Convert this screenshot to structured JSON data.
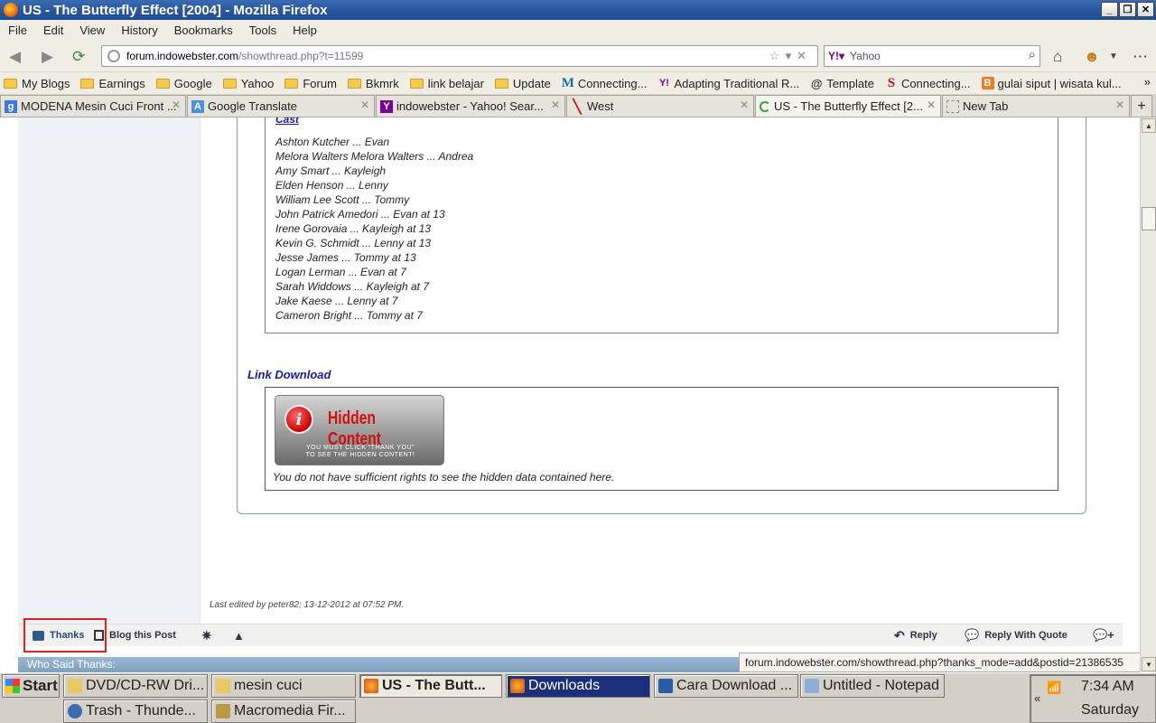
{
  "window": {
    "title": "US - The Butterfly Effect [2004] - Mozilla Firefox"
  },
  "menu": [
    "File",
    "Edit",
    "View",
    "History",
    "Bookmarks",
    "Tools",
    "Help"
  ],
  "nav": {
    "url_domain": "forum.indowebster.com",
    "url_path": "/showthread.php?t=11599",
    "search_placeholder": "Yahoo"
  },
  "bookmarks": [
    {
      "label": "My Blogs",
      "icon": "folder-icon"
    },
    {
      "label": "Earnings",
      "icon": "folder-icon"
    },
    {
      "label": "Google",
      "icon": "folder-icon"
    },
    {
      "label": "Yahoo",
      "icon": "folder-icon"
    },
    {
      "label": "Forum",
      "icon": "folder-icon"
    },
    {
      "label": "Bkmrk",
      "icon": "folder-icon"
    },
    {
      "label": "link belajar",
      "icon": "folder-icon"
    },
    {
      "label": "Update",
      "icon": "folder-icon"
    },
    {
      "label": "Connecting...",
      "icon": "m-icon"
    },
    {
      "label": "Adapting Traditional R...",
      "icon": "yahoo-icon"
    },
    {
      "label": "Template",
      "icon": "swirl-icon"
    },
    {
      "label": "Connecting...",
      "icon": "s-icon"
    },
    {
      "label": "gulai siput | wisata kul...",
      "icon": "blogger-icon"
    }
  ],
  "tabs": [
    {
      "label": "MODENA Mesin Cuci Front ...",
      "icon": "google-icon"
    },
    {
      "label": "Google Translate",
      "icon": "translate-icon"
    },
    {
      "label": "indowebster - Yahoo! Sear...",
      "icon": "yahoo-icon"
    },
    {
      "label": "West",
      "icon": "pin-icon"
    },
    {
      "label": "US - The Butterfly Effect [2...",
      "icon": "loading-icon"
    },
    {
      "label": "New Tab",
      "icon": "blank-icon"
    }
  ],
  "post": {
    "cast_label": "Cast",
    "cast": [
      "Ashton Kutcher ... Evan",
      "Melora Walters Melora Walters ... Andrea",
      "Amy Smart ... Kayleigh",
      "Elden Henson ... Lenny",
      "William Lee Scott ... Tommy",
      "John Patrick Amedori ... Evan at 13",
      "Irene Gorovaia ... Kayleigh at 13",
      "Kevin G. Schmidt ... Lenny at 13",
      "Jesse James ... Tommy at 13",
      "Logan Lerman ... Evan at 7",
      "Sarah Widdows ... Kayleigh at 7",
      "Jake Kaese ... Lenny at 7",
      "Cameron Bright ... Tommy at 7"
    ],
    "link_download": "Link Download",
    "hidden_title": "Hidden Content",
    "hidden_sub1": "YOU MUST CLICK \"THANK YOU\"",
    "hidden_sub2": "TO SEE THE HIDDEN CONTENT!",
    "hidden_note": "You do not have sufficient rights to see the hidden data contained here.",
    "last_edited": "Last edited by peter82; 13-12-2012 at 07:52 PM."
  },
  "postbar": {
    "thanks": "Thanks",
    "blog": "Blog this Post",
    "reply": "Reply",
    "reply_quote": "Reply With Quote"
  },
  "who_said": "Who Said Thanks:",
  "status_url": "forum.indowebster.com/showthread.php?thanks_mode=add&postid=21386535",
  "taskbar": {
    "start": "Start",
    "row1": [
      "DVD/CD-RW Dri...",
      "mesin cuci",
      "US - The Butt...",
      "Downloads",
      "Cara Download ...",
      "Untitled - Notepad"
    ],
    "row2": [
      "Trash - Thunde...",
      "Macromedia Fir..."
    ],
    "time": "7:34 AM",
    "day": "Saturday"
  }
}
